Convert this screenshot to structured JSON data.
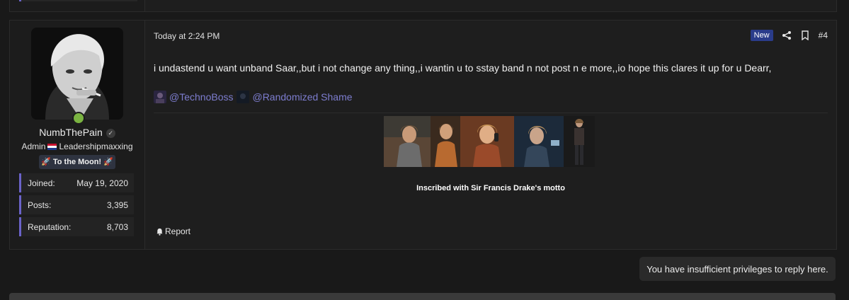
{
  "post": {
    "date": "Today at 2:24 PM",
    "new_badge": "New",
    "number": "#4",
    "message": "i undastend u want unband Saar,,but i not change any thing,,i wantin u to sstay band n not post n e more,,io hope this clares it up for u Dearr,",
    "mentions": [
      "@TechnoBoss",
      "@Randomized Shame"
    ],
    "signature_caption": "Inscribed with Sir Francis Drake's motto",
    "report_label": "Report"
  },
  "user": {
    "name": "NumbThePain",
    "role": "Admin",
    "group": "Leadershipmaxxing",
    "banner": "🚀 To the Moon! 🚀",
    "stats": [
      {
        "label": "Joined:",
        "value": "May 19, 2020"
      },
      {
        "label": "Posts:",
        "value": "3,395"
      },
      {
        "label": "Reputation:",
        "value": "8,703"
      }
    ]
  },
  "notice": "You have insufficient privileges to reply here.",
  "icons": {
    "share": "share-icon",
    "bookmark": "bookmark-icon",
    "verified": "verified-icon",
    "bell": "bell-icon"
  },
  "colors": {
    "accent": "#6b63c9",
    "mention": "#7d7dcf",
    "new_badge": "#2a3c8a",
    "online": "#7ab341"
  }
}
